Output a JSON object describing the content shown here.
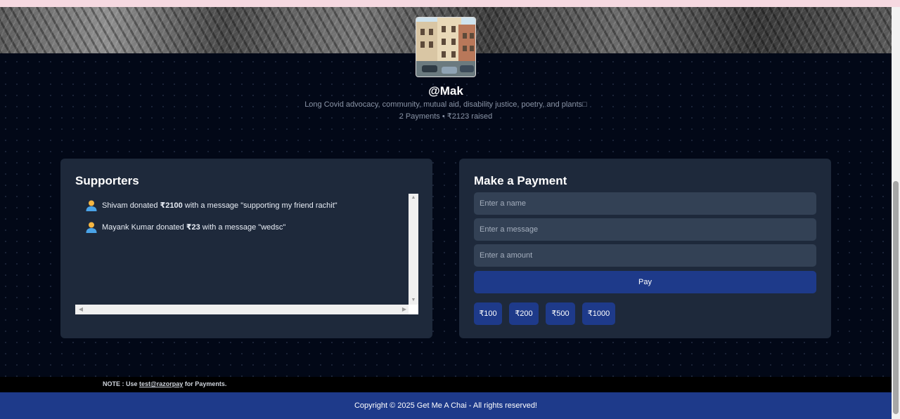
{
  "profile": {
    "username": "@Mak",
    "bio": "Long Covid advocacy, community, mutual aid, disability justice, poetry, and plants□",
    "stats": "2 Payments • ₹2123 raised"
  },
  "supporters": {
    "title": "Supporters",
    "items": [
      {
        "name": "Shivam",
        "verb": " donated ",
        "amount": "₹2100",
        "suffix": " with a message \"supporting my friend rachit\""
      },
      {
        "name": "Mayank Kumar",
        "verb": " donated ",
        "amount": "₹23",
        "suffix": " with a message \"wedsc\""
      }
    ]
  },
  "payment": {
    "title": "Make a Payment",
    "name_placeholder": "Enter a name",
    "message_placeholder": "Enter a message",
    "amount_placeholder": "Enter a amount",
    "pay_label": "Pay",
    "quick_amounts": [
      "₹100",
      "₹200",
      "₹500",
      "₹1000"
    ]
  },
  "note": {
    "prefix": "NOTE : Use ",
    "link": "test@razorpay",
    "suffix": " for Payments."
  },
  "footer": {
    "copyright": "Copyright © 2025 Get Me A Chai - All rights reserved!"
  },
  "colors": {
    "page_bg": "#020817",
    "panel_bg": "#1e293b",
    "input_bg": "#334155",
    "accent": "#1e3a8a"
  }
}
